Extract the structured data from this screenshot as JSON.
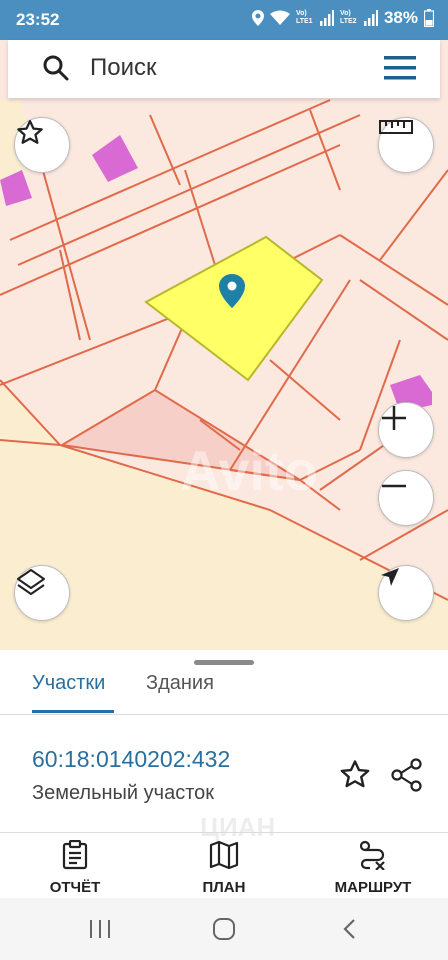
{
  "status_bar": {
    "time": "23:52",
    "battery": "38%",
    "network_1": "Vo) LTE1",
    "network_2": "Vo) LTE2"
  },
  "search": {
    "placeholder": "Поиск",
    "icon": "search-icon",
    "menu_icon": "hamburger-menu-icon"
  },
  "map": {
    "watermark": "Avito",
    "parcel_highlight_color": "#ffff66",
    "building_color": "#d96ad4",
    "boundary_color": "#e06a4a",
    "controls": [
      "star-icon",
      "ruler-icon",
      "zoom-in-icon",
      "zoom-out-icon",
      "layers-icon",
      "locate-icon"
    ]
  },
  "sheet": {
    "tabs": [
      {
        "label": "Участки",
        "active": true
      },
      {
        "label": "Здания",
        "active": false
      }
    ],
    "cadastral_number": "60:18:0140202:432",
    "object_type": "Земельный участок",
    "watermark": "ЦИАН"
  },
  "actions": [
    {
      "label": "ОТЧЁТ",
      "icon": "report-icon"
    },
    {
      "label": "ПЛАН",
      "icon": "map-plan-icon"
    },
    {
      "label": "МАРШРУТ",
      "icon": "route-icon"
    }
  ],
  "colors": {
    "accent": "#2a6f9e",
    "status_bar": "#4a8fc0"
  }
}
